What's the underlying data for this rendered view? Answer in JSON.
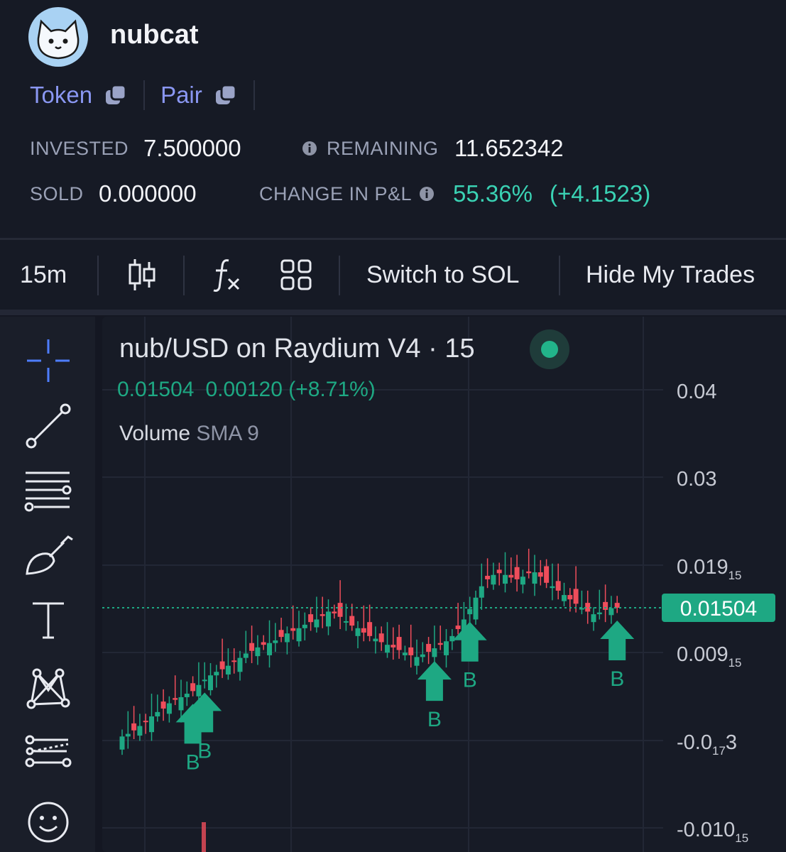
{
  "header": {
    "app_name": "nubcat",
    "links": [
      {
        "label": "Token"
      },
      {
        "label": "Pair"
      }
    ],
    "stats": {
      "invested_label": "INVESTED",
      "invested_value": "7.500000",
      "remaining_label": "REMAINING",
      "remaining_value": "11.652342",
      "sold_label": "SOLD",
      "sold_value": "0.000000",
      "pnl_label": "CHANGE IN P&L",
      "pnl_value": "55.36%",
      "pnl_change": "(+4.1523)"
    }
  },
  "toolbar": {
    "interval": "15m",
    "switch_label": "Switch to SOL",
    "hide_label": "Hide My Trades"
  },
  "chart": {
    "title": "nub/USD on Raydium V4 · 15",
    "ohlc_close": "0.01504",
    "ohlc_change": "0.00120 (+8.71%)",
    "volume_label": "Volume",
    "volume_sma": "SMA 9",
    "price_labels": [
      {
        "main": "0.04",
        "sub": ""
      },
      {
        "main": "0.03",
        "sub": ""
      },
      {
        "main": "0.019",
        "sub": "15"
      },
      {
        "main": "0.009",
        "sub": "15"
      },
      {
        "main": "-0.0",
        "sub": "17",
        "tail": "3"
      },
      {
        "main": "-0.010",
        "sub": "15"
      }
    ],
    "current_price": "0.01504",
    "buy_marker_label": "B",
    "colors": {
      "up": "#1ea883",
      "down": "#ef4d5b",
      "accent": "#8a97f2"
    }
  },
  "chart_data": {
    "type": "candlestick",
    "title": "nub/USD on Raydium V4 · 15",
    "current_price": 0.01504,
    "y_ticks": [
      "0.04",
      "0.03",
      "0.019₁₅",
      "0.009₁₅",
      "-0.0₁₇3",
      "-0.010₁₅"
    ],
    "close_series": [
      0.0003,
      0.0006,
      0.001,
      0.0015,
      0.002,
      0.0026,
      0.0031,
      0.0035,
      0.0041,
      0.0045,
      0.0048,
      0.0052,
      0.0055,
      0.0062,
      0.0068,
      0.0073,
      0.0077,
      0.008,
      0.0084,
      0.0089,
      0.0093,
      0.0098,
      0.0101,
      0.0105,
      0.0108,
      0.011,
      0.0113,
      0.0117,
      0.0121,
      0.0124,
      0.0127,
      0.0131,
      0.0134,
      0.0137,
      0.0141,
      0.0146,
      0.0144,
      0.014,
      0.0135,
      0.013,
      0.0127,
      0.0122,
      0.0118,
      0.0115,
      0.0111,
      0.0108,
      0.0105,
      0.0102,
      0.0099,
      0.0096,
      0.0094,
      0.0097,
      0.01,
      0.0104,
      0.0108,
      0.0112,
      0.0118,
      0.0126,
      0.0137,
      0.0149,
      0.0162,
      0.0175,
      0.0183,
      0.0188,
      0.019,
      0.0188,
      0.0185,
      0.0183,
      0.0186,
      0.019,
      0.0191,
      0.0186,
      0.0179,
      0.0175,
      0.017,
      0.0165,
      0.016,
      0.0155,
      0.015,
      0.0146,
      0.0143,
      0.0145,
      0.0148,
      0.015,
      0.01504
    ],
    "buy_markers_at_index": [
      12,
      14,
      53,
      59,
      87
    ]
  }
}
